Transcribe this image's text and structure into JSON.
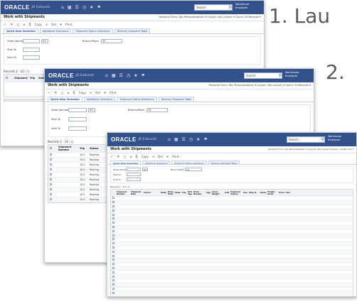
{
  "steps": [
    "1. Lau",
    "2."
  ],
  "app": {
    "logo": "ORACLE",
    "logo_sub": "JD Edwards",
    "header_icons": [
      "home-icon",
      "grid-icon",
      "doc-icon",
      "clock-icon",
      "star-icon",
      "flag-icon"
    ],
    "header_glyphs": [
      "⌂",
      "▦",
      "☰",
      "◷",
      "★",
      "⚑"
    ],
    "search_value": "Search",
    "search_glyph": "⚲",
    "user_line1": "Warehouse",
    "user_line2": "Employee",
    "title": "Work with Shipments",
    "personal_form": "Personal Form: (No Personalization) ▾   Layout: (No Layout) ▾   Query: All Records ▾",
    "toolbar": {
      "check": "✓",
      "close": "✕",
      "items": [
        "◫",
        "⊕",
        "⎘",
        "Copy",
        "⊖",
        "Del",
        "✉",
        "Print"
      ]
    },
    "tabs": [
      "Quick Item Selection",
      "Additional Selections",
      "Shipment Status Selections",
      "Delivery Shipment Table"
    ],
    "form": {
      "order_number_label": "Order Number",
      "branch_plant_label": "Branch/Plant",
      "ship_to_label": "Ship To",
      "sold_to_label": "Sold To",
      "order_type": "SO",
      "branch_plant": "30"
    },
    "grid_caption": "Records 1 - 10 ⟩ ⟩|"
  },
  "win1_rows": [],
  "win2": {
    "columns": [
      "",
      "Shipment Number",
      "Trip",
      "Status"
    ],
    "rows": [
      {
        "trip": "10.0",
        "status": "Routing"
      },
      {
        "trip": "10.0",
        "status": "Routing"
      },
      {
        "trip": "10.0",
        "status": "Routing"
      },
      {
        "trip": "10.0",
        "status": "Routing"
      },
      {
        "trip": "10.0",
        "status": "Routing"
      },
      {
        "trip": "10.0",
        "status": "Routing"
      },
      {
        "trip": "10.0",
        "status": "Routing"
      },
      {
        "trip": "10.0",
        "status": "Routing"
      },
      {
        "trip": "10.0",
        "status": "Routing"
      },
      {
        "trip": "10.0",
        "status": "Routing"
      }
    ]
  },
  "win3": {
    "columns": [
      "",
      "Shipment Number",
      "Shipment Date",
      "Carrier",
      "Mode",
      "Branch Plant",
      "Status",
      "Trip",
      "Order Type",
      "Order Number",
      "Type",
      "Gross Weight",
      "UoM",
      "Shipment Volume",
      "Zone",
      "Ship To",
      "Route",
      "Freight Terms",
      "Priority",
      "Zone"
    ],
    "rows": [
      [
        "",
        "",
        "",
        "",
        "",
        "",
        "",
        "",
        "",
        "",
        "",
        "",
        "",
        "",
        "",
        "",
        "",
        "",
        "",
        ""
      ],
      [
        "",
        "",
        "",
        "",
        "",
        "",
        "",
        "",
        "",
        "",
        "",
        "",
        "",
        "",
        "",
        "",
        "",
        "",
        "",
        ""
      ],
      [
        "",
        "",
        "",
        "",
        "",
        "",
        "",
        "",
        "",
        "",
        "",
        "",
        "",
        "",
        "",
        "",
        "",
        "",
        "",
        ""
      ],
      [
        "",
        "",
        "",
        "",
        "",
        "",
        "",
        "",
        "",
        "",
        "",
        "",
        "",
        "",
        "",
        "",
        "",
        "",
        "",
        ""
      ],
      [
        "",
        "",
        "",
        "",
        "",
        "",
        "",
        "",
        "",
        "",
        "",
        "",
        "",
        "",
        "",
        "",
        "",
        "",
        "",
        ""
      ],
      [
        "",
        "",
        "",
        "",
        "",
        "",
        "",
        "",
        "",
        "",
        "",
        "",
        "",
        "",
        "",
        "",
        "",
        "",
        "",
        ""
      ],
      [
        "",
        "",
        "",
        "",
        "",
        "",
        "",
        "",
        "",
        "",
        "",
        "",
        "",
        "",
        "",
        "",
        "",
        "",
        "",
        ""
      ],
      [
        "",
        "",
        "",
        "",
        "",
        "",
        "",
        "",
        "",
        "",
        "",
        "",
        "",
        "",
        "",
        "",
        "",
        "",
        "",
        ""
      ],
      [
        "",
        "",
        "",
        "",
        "",
        "",
        "",
        "",
        "",
        "",
        "",
        "",
        "",
        "",
        "",
        "",
        "",
        "",
        "",
        ""
      ],
      [
        "",
        "",
        "",
        "",
        "",
        "",
        "",
        "",
        "",
        "",
        "",
        "",
        "",
        "",
        "",
        "",
        "",
        "",
        "",
        ""
      ],
      [
        "",
        "",
        "",
        "",
        "",
        "",
        "",
        "",
        "",
        "",
        "",
        "",
        "",
        "",
        "",
        "",
        "",
        "",
        "",
        ""
      ],
      [
        "",
        "",
        "",
        "",
        "",
        "",
        "",
        "",
        "",
        "",
        "",
        "",
        "",
        "",
        "",
        "",
        "",
        "",
        "",
        ""
      ],
      [
        "",
        "",
        "",
        "",
        "",
        "",
        "",
        "",
        "",
        "",
        "",
        "",
        "",
        "",
        "",
        "",
        "",
        "",
        "",
        ""
      ],
      [
        "",
        "",
        "",
        "",
        "",
        "",
        "",
        "",
        "",
        "",
        "",
        "",
        "",
        "",
        "",
        "",
        "",
        "",
        "",
        ""
      ],
      [
        "",
        "",
        "",
        "",
        "",
        "",
        "",
        "",
        "",
        "",
        "",
        "",
        "",
        "",
        "",
        "",
        "",
        "",
        "",
        ""
      ],
      [
        "",
        "",
        "",
        "",
        "",
        "",
        "",
        "",
        "",
        "",
        "",
        "",
        "",
        "",
        "",
        "",
        "",
        "",
        "",
        ""
      ],
      [
        "",
        "",
        "",
        "",
        "",
        "",
        "",
        "",
        "",
        "",
        "",
        "",
        "",
        "",
        "",
        "",
        "",
        "",
        "",
        ""
      ],
      [
        "",
        "",
        "",
        "",
        "",
        "",
        "",
        "",
        "",
        "",
        "",
        "",
        "",
        "",
        "",
        "",
        "",
        "",
        "",
        ""
      ],
      [
        "",
        "",
        "",
        "",
        "",
        "",
        "",
        "",
        "",
        "",
        "",
        "",
        "",
        "",
        "",
        "",
        "",
        "",
        "",
        ""
      ],
      [
        "",
        "",
        "",
        "",
        "",
        "",
        "",
        "",
        "",
        "",
        "",
        "",
        "",
        "",
        "",
        "",
        "",
        "",
        "",
        ""
      ],
      [
        "",
        "",
        "",
        "",
        "",
        "",
        "",
        "",
        "",
        "",
        "",
        "",
        "",
        "",
        "",
        "",
        "",
        "",
        "",
        ""
      ],
      [
        "",
        "",
        "",
        "",
        "",
        "",
        "",
        "",
        "",
        "",
        "",
        "",
        "",
        "",
        "",
        "",
        "",
        "",
        "",
        ""
      ],
      [
        "",
        "",
        "",
        "",
        "",
        "",
        "",
        "",
        "",
        "",
        "",
        "",
        "",
        "",
        "",
        "",
        "",
        "",
        "",
        ""
      ],
      [
        "",
        "",
        "",
        "",
        "",
        "",
        "",
        "",
        "",
        "",
        "",
        "",
        "",
        "",
        "",
        "",
        "",
        "",
        "",
        ""
      ],
      [
        "",
        "",
        "",
        "",
        "",
        "",
        "",
        "",
        "",
        "",
        "",
        "",
        "",
        "",
        "",
        "",
        "",
        "",
        "",
        ""
      ]
    ]
  }
}
